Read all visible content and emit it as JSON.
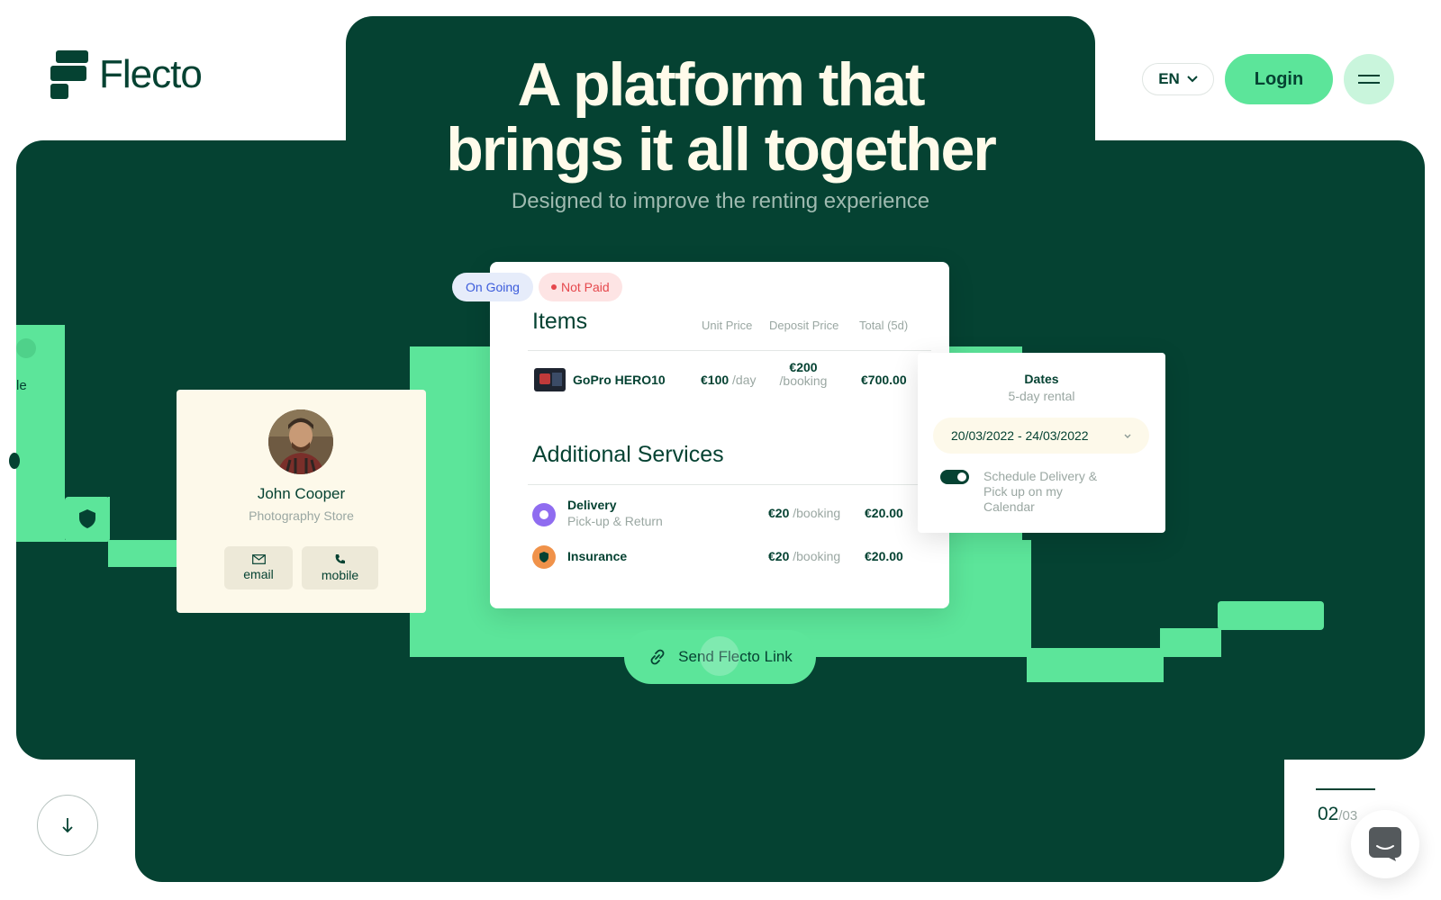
{
  "brand": {
    "name": "Flecto"
  },
  "header": {
    "language": "EN",
    "login_label": "Login"
  },
  "hero": {
    "title_line1": "A platform that",
    "title_line2": "brings it all together",
    "subtitle": "Designed to improve the renting experience"
  },
  "side_fragment": {
    "text": "le"
  },
  "order": {
    "status_ongoing": "On Going",
    "status_payment": "Not Paid",
    "items_heading": "Items",
    "columns": [
      "Unit Price",
      "Deposit Price",
      "Total (5d)"
    ],
    "items": [
      {
        "name": "GoPro HERO10",
        "unit_price": "€100",
        "unit_suffix": "/day",
        "deposit": "€200",
        "deposit_suffix": "/booking",
        "total": "€700.00"
      }
    ],
    "services_heading": "Additional Services",
    "services": [
      {
        "name": "Delivery",
        "detail": "Pick-up & Return",
        "price": "€20",
        "price_suffix": "/booking",
        "total": "€20.00"
      },
      {
        "name": "Insurance",
        "detail": "",
        "price": "€20",
        "price_suffix": "/booking",
        "total": "€20.00"
      }
    ]
  },
  "dates": {
    "heading": "Dates",
    "duration": "5-day rental",
    "range": "20/03/2022 - 24/03/2022",
    "toggle_line1": "Schedule Delivery &",
    "toggle_line2": "Pick up on my",
    "toggle_line3": "Calendar",
    "toggle_on": true
  },
  "profile": {
    "name": "John Cooper",
    "store": "Photography Store",
    "email_label": "email",
    "mobile_label": "mobile"
  },
  "send_label": "Send Flecto Link",
  "pagination": {
    "current": "02",
    "total": "/03"
  },
  "icons": [
    "chevron-down-icon",
    "menu-icon",
    "mail-icon",
    "phone-icon",
    "link-icon",
    "arrow-down-icon",
    "chat-icon",
    "shield-icon",
    "delivery-icon"
  ],
  "colors": {
    "dark_green": "#054232",
    "accent_green": "#5ce59a",
    "cream": "#fdf9ea",
    "badge_red": "#e5484d",
    "badge_blue": "#3b5bdb"
  }
}
